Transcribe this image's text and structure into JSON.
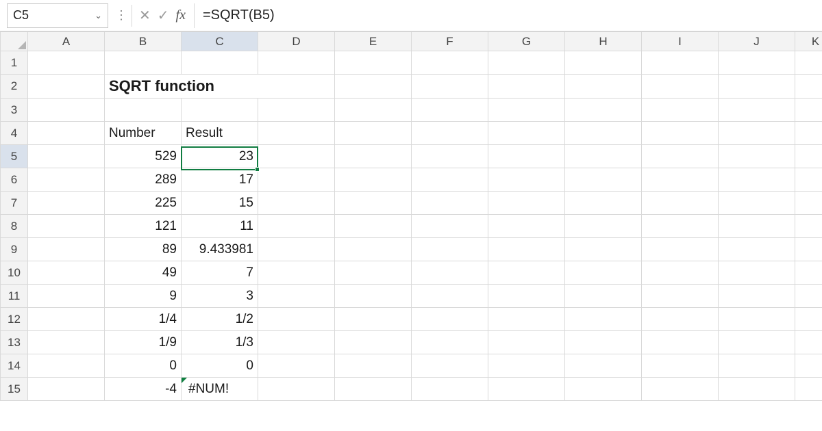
{
  "formula_bar": {
    "cell_ref": "C5",
    "formula": "=SQRT(B5)",
    "cancel_icon": "✕",
    "confirm_icon": "✓",
    "fx_label": "fx",
    "dropdown_glyph": "⌄",
    "dots": "⋮"
  },
  "columns": [
    "A",
    "B",
    "C",
    "D",
    "E",
    "F",
    "G",
    "H",
    "I",
    "J",
    "K"
  ],
  "rows": [
    "1",
    "2",
    "3",
    "4",
    "5",
    "6",
    "7",
    "8",
    "9",
    "10",
    "11",
    "12",
    "13",
    "14",
    "15"
  ],
  "title": "SQRT function",
  "table": {
    "headers": {
      "b": "Number",
      "c": "Result"
    },
    "rows": [
      {
        "b": "529",
        "c": "23"
      },
      {
        "b": "289",
        "c": "17"
      },
      {
        "b": "225",
        "c": "15"
      },
      {
        "b": "121",
        "c": "11"
      },
      {
        "b": "89",
        "c": "9.433981"
      },
      {
        "b": "49",
        "c": "7"
      },
      {
        "b": "9",
        "c": "3"
      },
      {
        "b": " 1/4",
        "c": " 1/2"
      },
      {
        "b": " 1/9",
        "c": " 1/3"
      },
      {
        "b": "0",
        "c": "0"
      },
      {
        "b": "-4",
        "c": "#NUM!"
      }
    ]
  },
  "chart_data": {
    "type": "table",
    "title": "SQRT function",
    "columns": [
      "Number",
      "Result"
    ],
    "rows": [
      [
        529,
        23
      ],
      [
        289,
        17
      ],
      [
        225,
        15
      ],
      [
        121,
        11
      ],
      [
        89,
        9.433981
      ],
      [
        49,
        7
      ],
      [
        9,
        3
      ],
      [
        0.25,
        0.5
      ],
      [
        0.1111111,
        0.3333333
      ],
      [
        0,
        0
      ],
      [
        -4,
        "#NUM!"
      ]
    ]
  },
  "active_cell": "C5"
}
